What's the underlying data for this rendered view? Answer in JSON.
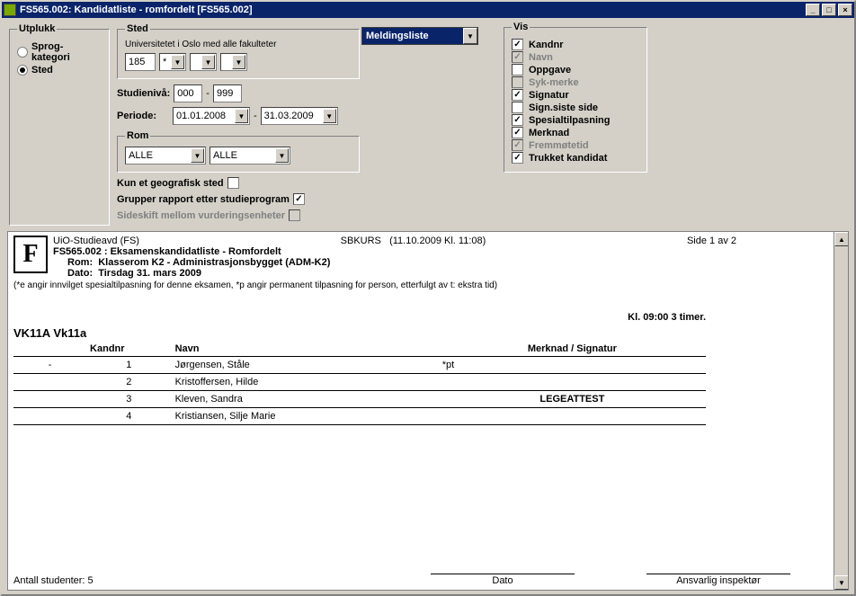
{
  "window": {
    "title": "FS565.002: Kandidatliste - romfordelt [FS565.002]"
  },
  "utplukk": {
    "legend": "Utplukk",
    "opt1": "Sprog-kategori",
    "opt2": "Sted"
  },
  "sted": {
    "legend": "Sted",
    "uni": "Universitetet i Oslo med alle fakulteter",
    "code": "185",
    "star": "*",
    "blank1": "",
    "blank2": "",
    "studieniva_lbl": "Studienivå:",
    "studieniva_from": "000",
    "studieniva_to": "999",
    "periode_lbl": "Periode:",
    "periode_from": "01.01.2008",
    "periode_to": "31.03.2009"
  },
  "rom": {
    "legend": "Rom",
    "v1": "ALLE",
    "v2": "ALLE"
  },
  "opts": {
    "kun_geo": "Kun et geografisk sted",
    "grupper": "Grupper rapport etter studieprogram",
    "sideskift": "Sideskift mellom vurderingsenheter"
  },
  "meldingsliste": "Meldingsliste",
  "vis": {
    "legend": "Vis",
    "kandnr": "Kandnr",
    "navn": "Navn",
    "oppgave": "Oppgave",
    "sykmerke": "Syk-merke",
    "signatur": "Signatur",
    "signsiste": "Sign.siste side",
    "spesial": "Spesialtilpasning",
    "merknad": "Merknad",
    "fremmote": "Fremmøtetid",
    "trukket": "Trukket kandidat"
  },
  "report": {
    "hdr_left": "UiO-Studieavd (FS)",
    "hdr_mid": "SBKURS",
    "hdr_time": "(11.10.2009 Kl. 11:08)",
    "hdr_page": "Side 1 av 2",
    "title": "FS565.002 : Eksamenskandidatliste - Romfordelt",
    "rom_lbl": "Rom:",
    "rom_val": "Klasserom K2 - Administrasjonsbygget (ADM-K2)",
    "dato_lbl": "Dato:",
    "dato_val": "Tirsdag 31. mars 2009",
    "footnote": "(*e angir innvilget spesialtilpasning for denne eksamen, *p angir permanent tilpasning for person, etterfulgt av t: ekstra tid)",
    "time_note": "Kl. 09:00 3 timer.",
    "course": "VK11A Vk11a",
    "th_kandnr": "Kandnr",
    "th_navn": "Navn",
    "th_merk": "Merknad / Signatur",
    "rows": [
      {
        "mark": "-",
        "nr": "1",
        "navn": "Jørgensen, Ståle",
        "merk": "*pt"
      },
      {
        "mark": "",
        "nr": "2",
        "navn": "Kristoffersen, Hilde",
        "merk": ""
      },
      {
        "mark": "",
        "nr": "3",
        "navn": "Kleven, Sandra",
        "merk": "LEGEATTEST"
      },
      {
        "mark": "",
        "nr": "4",
        "navn": "Kristiansen, Silje Marie",
        "merk": ""
      }
    ],
    "foot_count": "Antall studenter: 5",
    "foot_dato": "Dato",
    "foot_insp": "Ansvarlig inspektør"
  }
}
